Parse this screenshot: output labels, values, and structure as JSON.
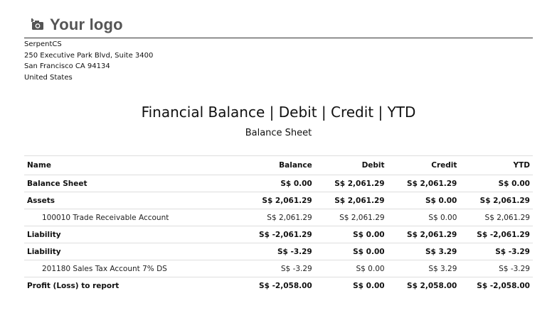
{
  "logo": {
    "text": "Your logo",
    "icon": "camera-icon"
  },
  "company": {
    "name": "SerpentCS",
    "address_line1": "250 Executive Park Blvd, Suite 3400",
    "address_line2": "San Francisco CA 94134",
    "country": "United States"
  },
  "report": {
    "title": "Financial Balance | Debit | Credit | YTD",
    "subtitle": "Balance Sheet"
  },
  "table": {
    "columns": [
      "Name",
      "Balance",
      "Debit",
      "Credit",
      "YTD"
    ],
    "rows": [
      {
        "name": "Balance Sheet",
        "balance": "S$ 0.00",
        "debit": "S$ 2,061.29",
        "credit": "S$ 2,061.29",
        "ytd": "S$ 0.00"
      },
      {
        "name": "Assets",
        "balance": "S$ 2,061.29",
        "debit": "S$ 2,061.29",
        "credit": "S$ 0.00",
        "ytd": "S$ 2,061.29"
      },
      {
        "name": "100010 Trade Receivable Account",
        "balance": "S$ 2,061.29",
        "debit": "S$ 2,061.29",
        "credit": "S$ 0.00",
        "ytd": "S$ 2,061.29"
      },
      {
        "name": "Liability",
        "balance": "S$ -2,061.29",
        "debit": "S$ 0.00",
        "credit": "S$ 2,061.29",
        "ytd": "S$ -2,061.29"
      },
      {
        "name": "Liability",
        "balance": "S$ -3.29",
        "debit": "S$ 0.00",
        "credit": "S$ 3.29",
        "ytd": "S$ -3.29"
      },
      {
        "name": "201180 Sales Tax Account 7% DS",
        "balance": "S$ -3.29",
        "debit": "S$ 0.00",
        "credit": "S$ 3.29",
        "ytd": "S$ -3.29"
      },
      {
        "name": "Profit (Loss) to report",
        "balance": "S$ -2,058.00",
        "debit": "S$ 0.00",
        "credit": "S$ 2,058.00",
        "ytd": "S$ -2,058.00"
      }
    ]
  }
}
